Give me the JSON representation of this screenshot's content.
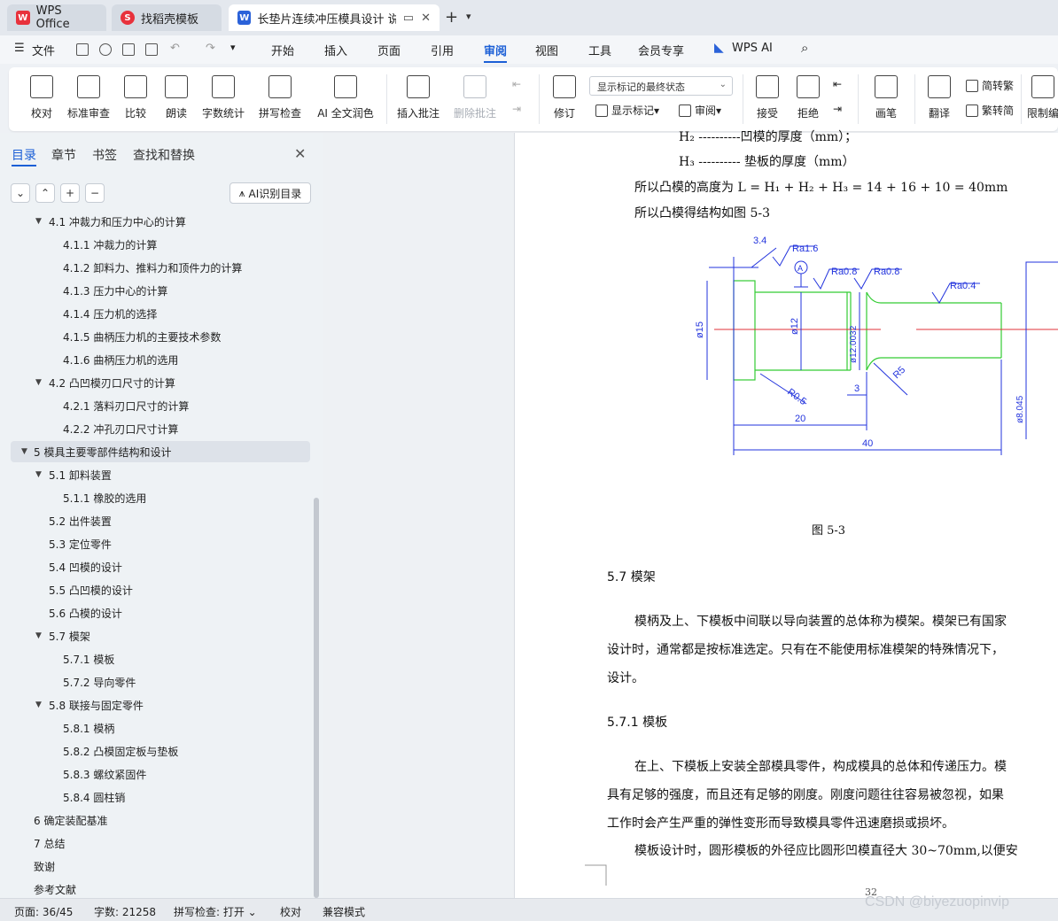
{
  "tabs": [
    {
      "label": "WPS Office",
      "icon": "wps-logo-icon"
    },
    {
      "label": "找稻壳模板",
      "icon": "docer-icon"
    },
    {
      "label": "长垫片连续冲压模具设计 说明",
      "icon": "word-doc-icon"
    }
  ],
  "menu": {
    "file": "文件",
    "items": [
      "开始",
      "插入",
      "页面",
      "引用",
      "审阅",
      "视图",
      "工具",
      "会员专享"
    ],
    "active": "审阅",
    "wps_ai": "WPS AI"
  },
  "ribbon": {
    "proofread": "校对",
    "std_review": "标准审查",
    "compare": "比较",
    "read_aloud": "朗读",
    "word_count": "字数统计",
    "spell_check": "拼写检查",
    "ai_polish": "AI 全文润色",
    "insert_comment": "插入批注",
    "delete_comment": "删除批注",
    "revise": "修订",
    "markup_state": "显示标记的最终状态",
    "show_markup": "显示标记",
    "review": "审阅",
    "accept": "接受",
    "reject": "拒绝",
    "pen": "画笔",
    "translate": "翻译",
    "to_traditional": "简转繁",
    "to_simplified": "繁转简",
    "restrict_edit": "限制编"
  },
  "sidebar": {
    "tabs": [
      "目录",
      "章节",
      "书签",
      "查找和替换"
    ],
    "ai_toc": "AI识别目录",
    "toc": [
      {
        "label": "4.1   冲裁力和压力中心的计算",
        "level": 2,
        "expanded": true
      },
      {
        "label": "4.1.1   冲裁力的计算",
        "level": 3
      },
      {
        "label": "4.1.2  卸料力、推料力和顶件力的计算",
        "level": 3
      },
      {
        "label": "4.1.3  压力中心的计算",
        "level": 3
      },
      {
        "label": "4.1.4 压力机的选择",
        "level": 3
      },
      {
        "label": "4.1.5  曲柄压力机的主要技术参数",
        "level": 3
      },
      {
        "label": "4.1.6 曲柄压力机的选用",
        "level": 3
      },
      {
        "label": "4.2  凸凹模刃口尺寸的计算",
        "level": 2,
        "expanded": true
      },
      {
        "label": "4.2.1  落料刃口尺寸的计算",
        "level": 3
      },
      {
        "label": "4.2.2  冲孔刃口尺寸计算",
        "level": 3
      },
      {
        "label": "5    模具主要零部件结构和设计",
        "level": 1,
        "expanded": true,
        "selected": true
      },
      {
        "label": "5.1    卸料装置",
        "level": 2,
        "expanded": true
      },
      {
        "label": "5.1.1     橡胶的选用",
        "level": 3
      },
      {
        "label": "5.2    出件装置",
        "level": 2
      },
      {
        "label": "5.3    定位零件",
        "level": 2
      },
      {
        "label": "5.4    凹模的设计",
        "level": 2
      },
      {
        "label": "5.5    凸凹模的设计",
        "level": 2
      },
      {
        "label": "5.6    凸模的设计",
        "level": 2
      },
      {
        "label": "5.7    模架",
        "level": 2,
        "expanded": true
      },
      {
        "label": "5.7.1     模板",
        "level": 3
      },
      {
        "label": "5.7.2     导向零件",
        "level": 3
      },
      {
        "label": "5.8    联接与固定零件",
        "level": 2,
        "expanded": true
      },
      {
        "label": "5.8.1     模柄",
        "level": 3
      },
      {
        "label": "5.8.2     凸模固定板与垫板",
        "level": 3
      },
      {
        "label": "5.8.3     螺纹紧固件",
        "level": 3
      },
      {
        "label": "5.8.4     圆柱销",
        "level": 3
      },
      {
        "label": "6    确定装配基准",
        "level": 1
      },
      {
        "label": "7    总结",
        "level": 1
      },
      {
        "label": "致谢",
        "level": 1
      },
      {
        "label": "参考文献",
        "level": 1
      }
    ]
  },
  "document": {
    "line_h2": "H₂ ----------凹模的厚度（mm）；",
    "line_h3": "H₃ ----------  垫板的厚度（mm）",
    "formula": "所以凸模的高度为 L = H₁ + H₂ + H₃ = 14 + 16 + 10 = 40mm",
    "fig_intro": "所以凸模得结构如图 5-3",
    "drawing": {
      "dim_34": "3.4",
      "ra16": "Ra1.6",
      "ra08a": "Ra0.8",
      "ra08b": "Ra0.8",
      "ra04": "Ra0.4",
      "datum": "A",
      "d15": "ø15",
      "d12": "ø12",
      "d12tol": "ø12.0032",
      "d8tol": "ø8.045",
      "r05": "R0.5",
      "r5": "R5",
      "dim3": "3",
      "dim20": "20",
      "dim40": "40"
    },
    "caption": "图 5-3",
    "h_57": "5.7   模架",
    "p1_l1": "模柄及上、下模板中间联以导向装置的总体称为模架。模架已有国家",
    "p1_l2": "设计时，通常都是按标准选定。只有在不能使用标准模架的特殊情况下，",
    "p1_l3": "设计。",
    "h_571": "5.7.1   模板",
    "p2_l1": "在上、下模板上安装全部模具零件，构成模具的总体和传递压力。模",
    "p2_l2": "具有足够的强度，而且还有足够的刚度。刚度问题往往容易被忽视，如果",
    "p2_l3": "工作时会产生严重的弹性变形而导致模具零件迅速磨损或损坏。",
    "p3_l1": "模板设计时，圆形模板的外径应比圆形凹模直径大 30~70mm,以便安",
    "page_num": "32"
  },
  "status": {
    "page": "页面: 36/45",
    "words": "字数: 21258",
    "spell": "拼写检查: 打开",
    "proof": "校对",
    "compat": "兼容模式"
  },
  "watermark": "CSDN @biyezuopinvip",
  "colors": {
    "accent": "#1b5fd6",
    "drawing_green": "#33cc33",
    "drawing_blue": "#2233dd",
    "centerline_red": "#e0303a"
  }
}
